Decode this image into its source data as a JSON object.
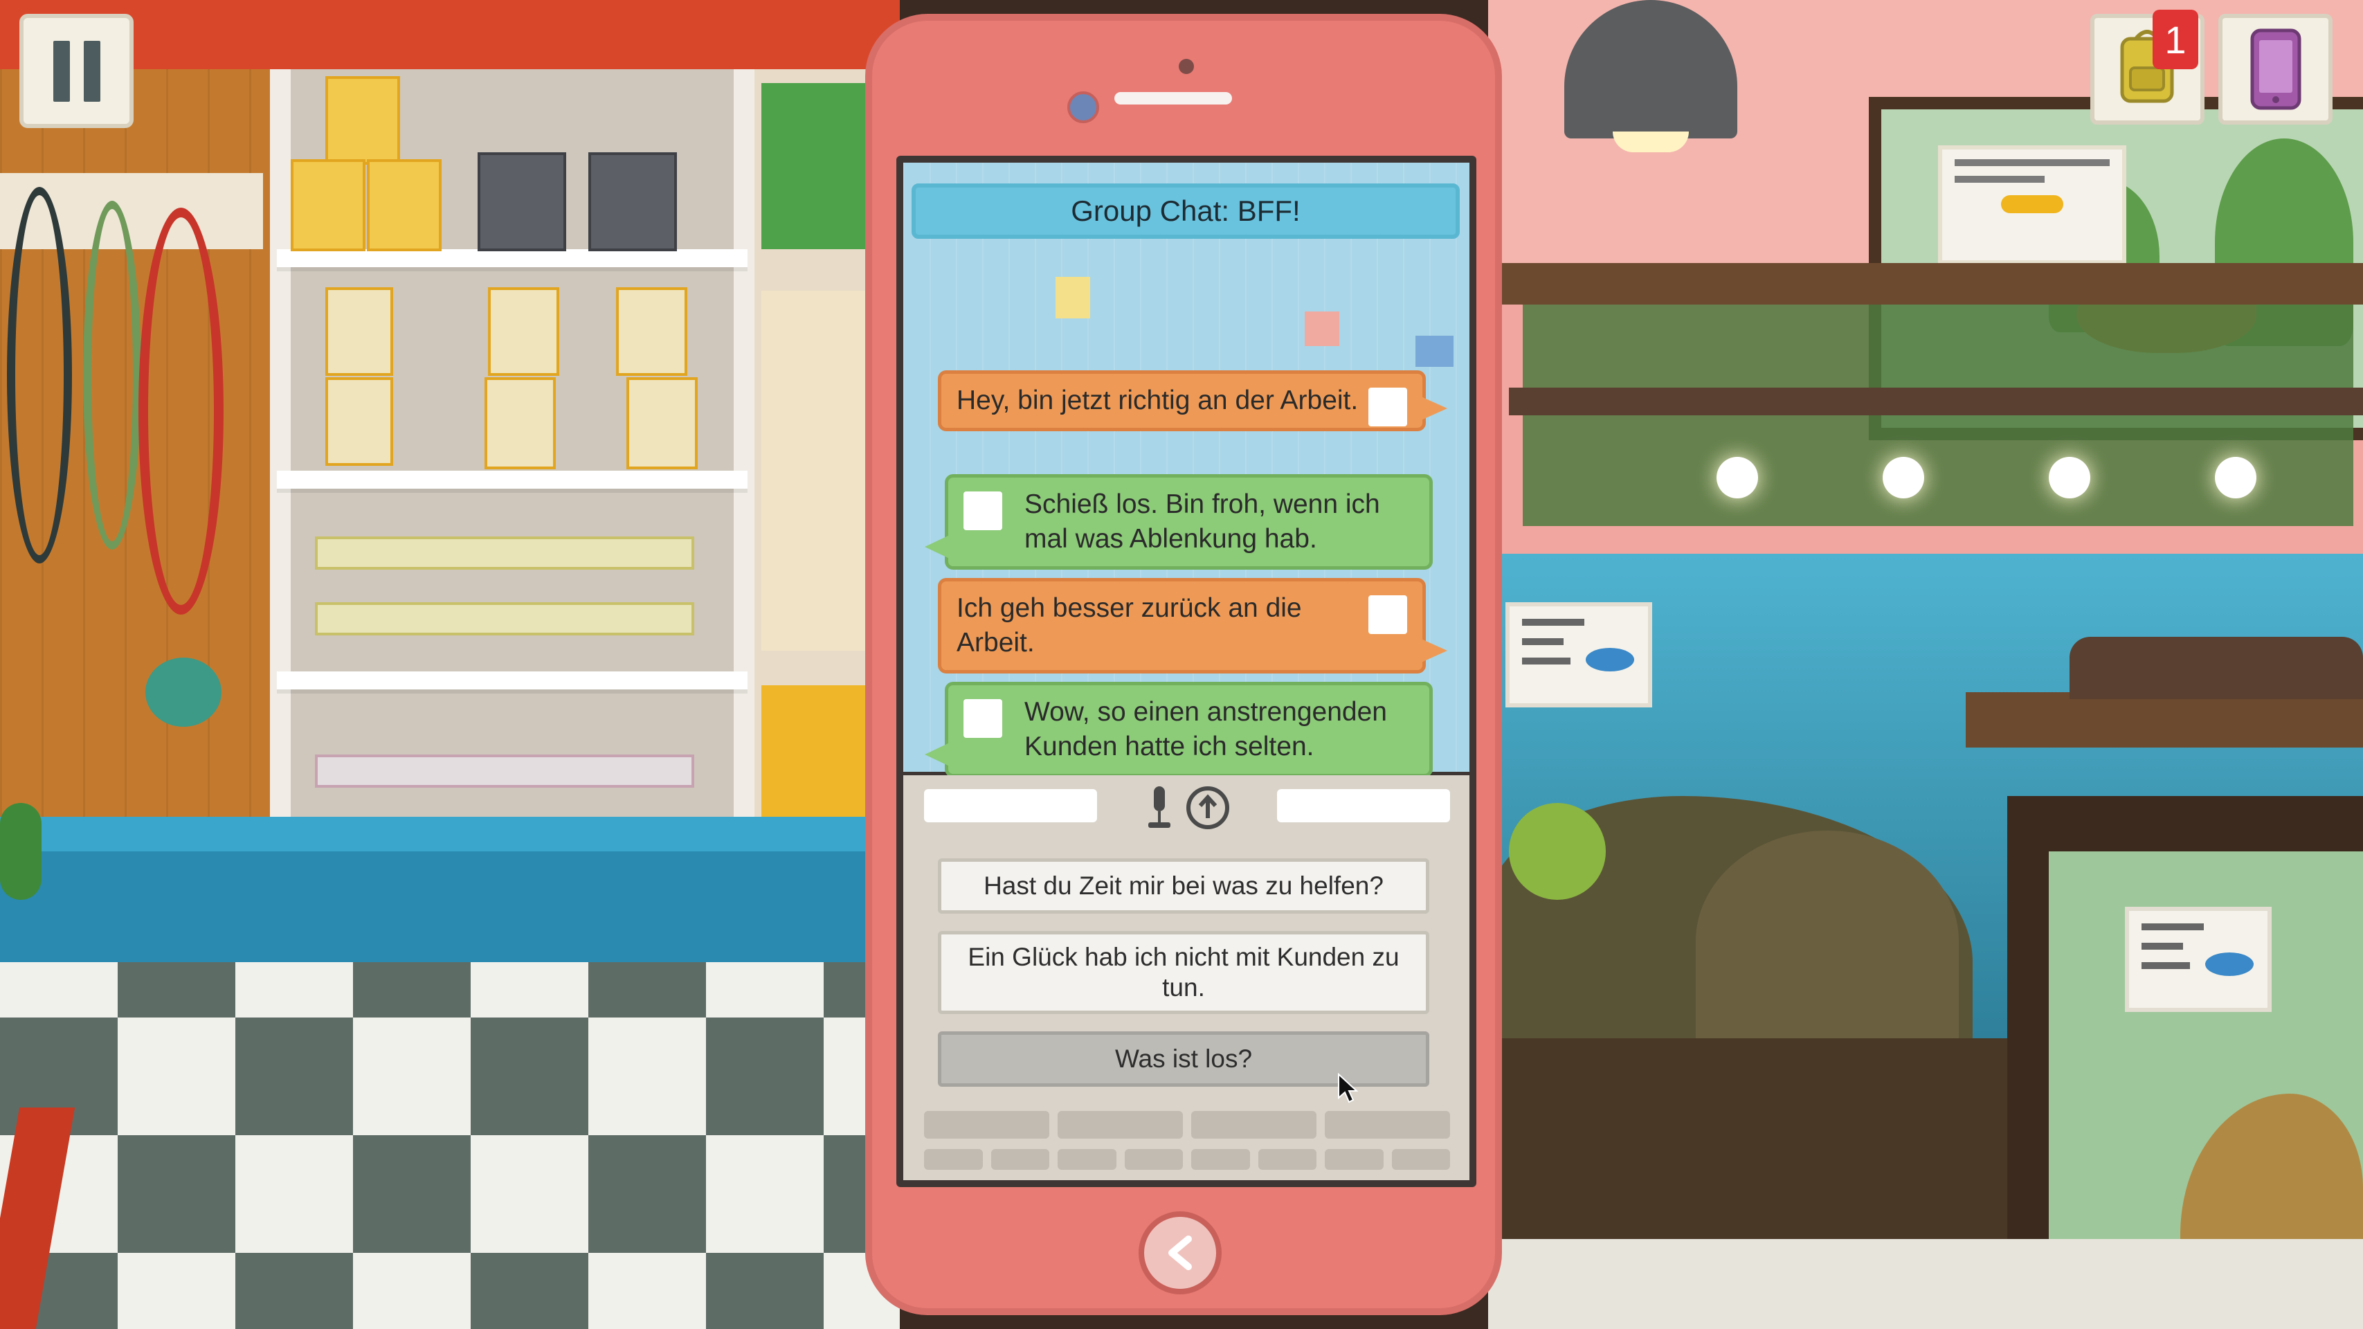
{
  "chat": {
    "title": "Group Chat: BFF!",
    "messages": [
      {
        "from": "player",
        "text": "Hey, bin jetzt richtig an der Arbeit."
      },
      {
        "from": "friend",
        "text": "Schieß los. Bin froh, wenn ich mal was Ablenkung hab."
      },
      {
        "from": "player",
        "text": "Ich geh besser zurück an die Arbeit."
      },
      {
        "from": "friend",
        "text": "Wow, so einen anstrengenden Kunden hatte ich selten."
      }
    ]
  },
  "replies": {
    "options": [
      {
        "text": "Hast du Zeit mir bei was zu helfen?"
      },
      {
        "text": "Ein Glück hab ich nicht mit Kunden zu tun."
      },
      {
        "text": "Was ist los?"
      }
    ],
    "selected_index": 2
  },
  "hud": {
    "pause_icon": "pause-icon",
    "backpack_icon": "backpack-icon",
    "notification_count": "1",
    "phone_icon": "phone-icon"
  },
  "colors": {
    "phone_body": "#e87b74",
    "player_bubble": "#ee9a56",
    "friend_bubble": "#8ccb78",
    "chat_title": "#69c3de",
    "badge": "#e03333"
  }
}
